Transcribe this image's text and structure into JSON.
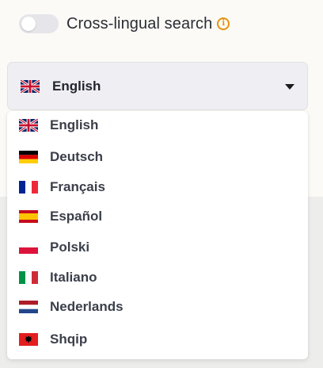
{
  "toggle": {
    "label": "Cross-lingual search",
    "enabled": false,
    "info_icon": "info-icon"
  },
  "select": {
    "selected_label": "English",
    "selected_flag": "uk-flag-icon",
    "expanded": true
  },
  "options": [
    {
      "label": "English",
      "flag": "uk-flag-icon"
    },
    {
      "label": "Deutsch",
      "flag": "germany-flag-icon"
    },
    {
      "label": "Français",
      "flag": "france-flag-icon"
    },
    {
      "label": "Español",
      "flag": "spain-flag-icon"
    },
    {
      "label": "Polski",
      "flag": "poland-flag-icon"
    },
    {
      "label": "Italiano",
      "flag": "italy-flag-icon"
    },
    {
      "label": "Nederlands",
      "flag": "netherlands-flag-icon"
    },
    {
      "label": "Shqip",
      "flag": "albania-flag-icon"
    }
  ],
  "colors": {
    "accent": "#e8910f",
    "select_background": "#efeef3",
    "page_background": "#fbfaf6"
  }
}
